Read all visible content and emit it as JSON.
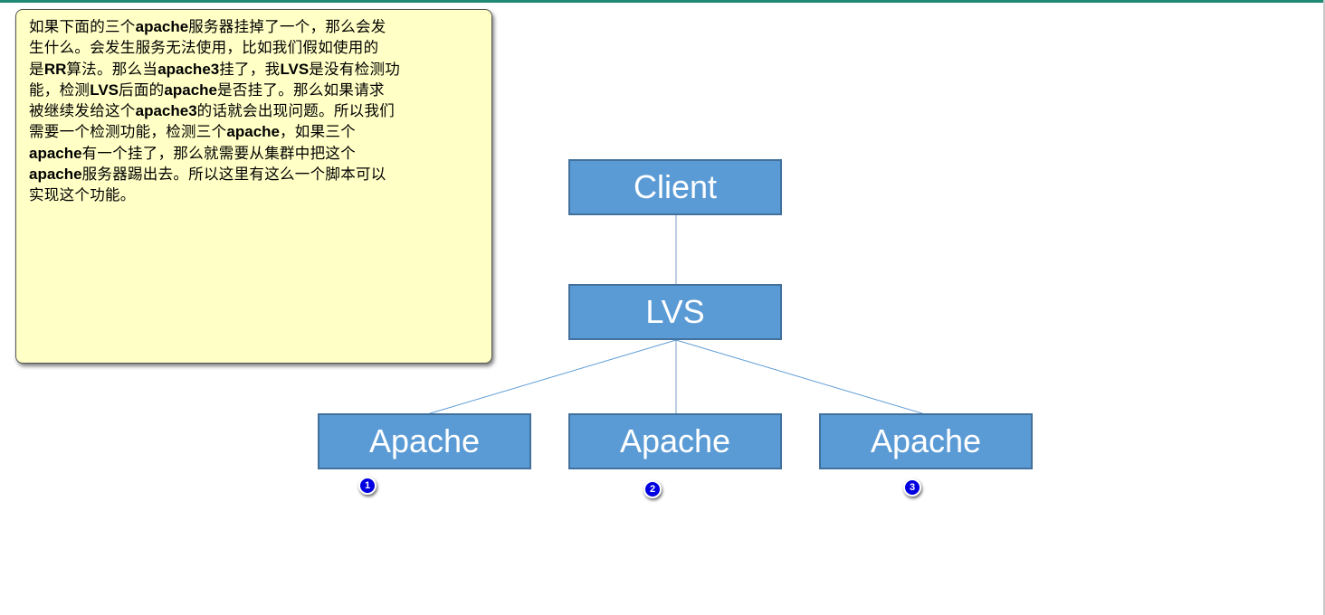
{
  "note": {
    "lines": [
      "如果下面的三个apache服务器挂掉了一个，那么会发",
      "生什么。会发生服务无法使用，比如我们假如使用的",
      "是RR算法。那么当apache3挂了，我LVS是没有检测功",
      "能，检测LVS后面的apache是否挂了。那么如果请求",
      "被继续发给这个apache3的话就会出现问题。所以我们",
      "需要一个检测功能，检测三个apache，如果三个",
      "apache有一个挂了，那么就需要从集群中把这个",
      "apache服务器踢出去。所以这里有这么一个脚本可以",
      "实现这个功能。"
    ]
  },
  "diagram": {
    "client": "Client",
    "lvs": "LVS",
    "apaches": [
      "Apache",
      "Apache",
      "Apache"
    ],
    "badges": [
      "1",
      "2",
      "3"
    ],
    "colors": {
      "box_fill": "#5b9bd5",
      "box_border": "#41719c",
      "badge": "#0000e0",
      "note_bg": "#ffffc6"
    }
  }
}
